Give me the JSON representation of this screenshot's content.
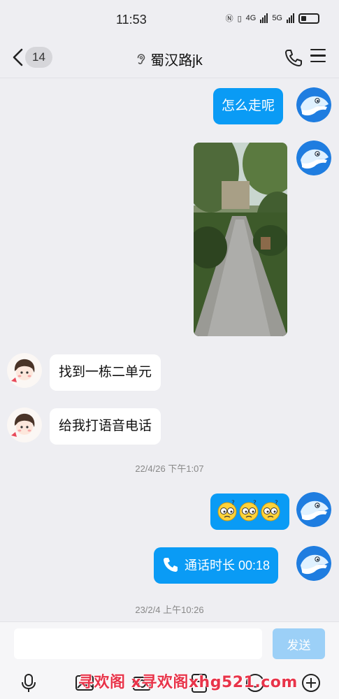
{
  "status_bar": {
    "time": "11:53",
    "net1": "4G",
    "net2": "5G"
  },
  "header": {
    "unread_count": "14",
    "chat_title": "蜀汉路jk"
  },
  "messages": {
    "m1": "怎么走呢",
    "m3": "找到一栋二单元",
    "m4": "给我打语音电话",
    "ts1": "22/4/26 下午1:07",
    "m6_call": "通话时长 00:18",
    "ts2": "23/2/4 上午10:26"
  },
  "input": {
    "placeholder": "",
    "value": "",
    "send_label": "发送"
  },
  "watermark": "寻欢阁 x寻欢阁xhg521.com",
  "colors": {
    "accent": "#0a9bf5",
    "background": "#eeeef2",
    "send_disabled": "#9cd0f7"
  }
}
